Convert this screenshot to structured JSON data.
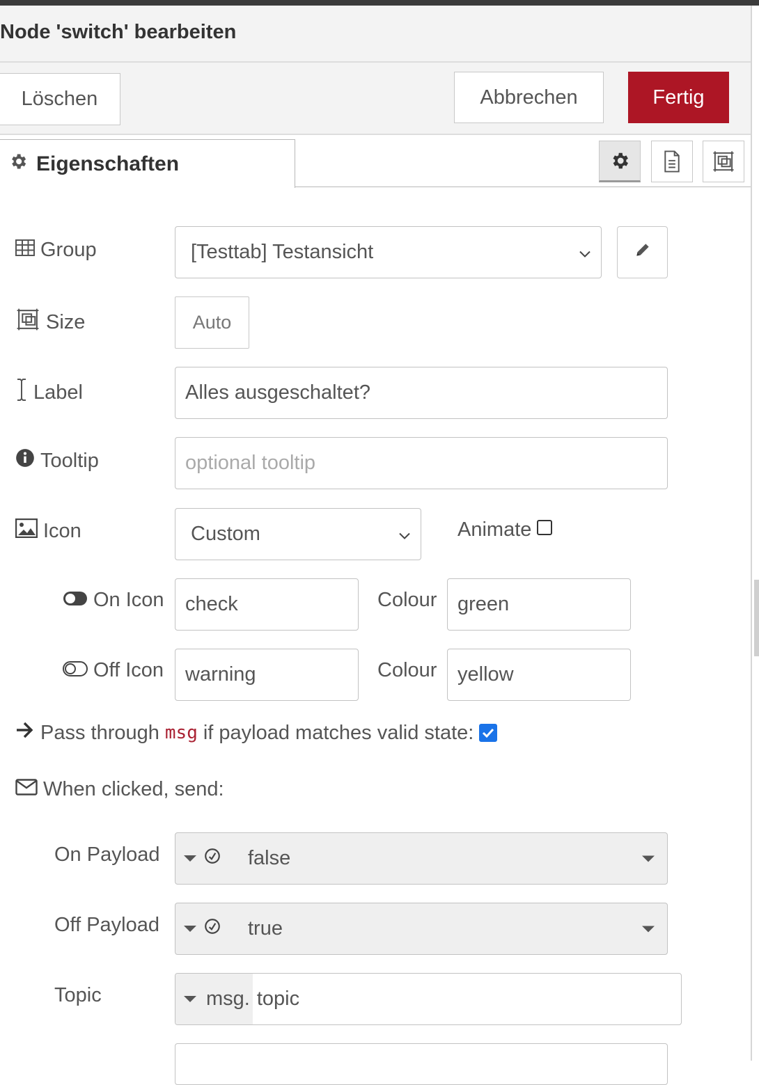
{
  "header": {
    "title": "Node 'switch' bearbeiten"
  },
  "buttons": {
    "delete": "Löschen",
    "cancel": "Abbrechen",
    "done": "Fertig"
  },
  "tabs": {
    "properties": "Eigenschaften",
    "icons": [
      "gear-icon",
      "document-icon",
      "layout-icon"
    ]
  },
  "form": {
    "group": {
      "label": "Group",
      "value": "[Testtab] Testansicht"
    },
    "size": {
      "label": "Size",
      "value": "Auto"
    },
    "label": {
      "label": "Label",
      "value": "Alles ausgeschaltet?"
    },
    "tooltip": {
      "label": "Tooltip",
      "placeholder": "optional tooltip"
    },
    "icon": {
      "label": "Icon",
      "value": "Custom",
      "animate_label": "Animate",
      "animate_checked": false
    },
    "on_icon": {
      "label": "On Icon",
      "value": "check",
      "colour_label": "Colour",
      "colour_value": "green"
    },
    "off_icon": {
      "label": "Off Icon",
      "value": "warning",
      "colour_label": "Colour",
      "colour_value": "yellow"
    },
    "pass_through": {
      "text_before": "Pass through",
      "code": "msg",
      "text_after": "if payload matches valid state:",
      "checked": true
    },
    "when_clicked": {
      "label": "When clicked, send:"
    },
    "on_payload": {
      "label": "On Payload",
      "value": "false"
    },
    "off_payload": {
      "label": "Off Payload",
      "value": "true"
    },
    "topic": {
      "label": "Topic",
      "prefix": "msg.",
      "value": "topic"
    }
  },
  "colors": {
    "primary": "#ad1625",
    "checkbox": "#1a73e8"
  }
}
